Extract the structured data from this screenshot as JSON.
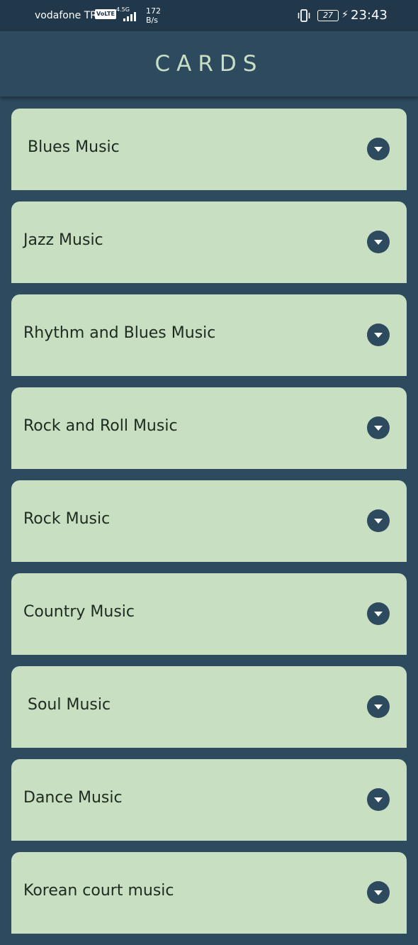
{
  "status_bar": {
    "carrier": "vodafone TR",
    "volte": "VoLTE",
    "network": "4.5G",
    "speed_value": "172",
    "speed_unit": "B/s",
    "battery": "27",
    "time": "23:43"
  },
  "app_bar": {
    "title": "CARDS"
  },
  "cards": [
    {
      "label": "Blues Music"
    },
    {
      "label": "Jazz Music"
    },
    {
      "label": "Rhythm and Blues Music"
    },
    {
      "label": "Rock and Roll Music"
    },
    {
      "label": "Rock Music"
    },
    {
      "label": "Country Music"
    },
    {
      "label": "Soul Music"
    },
    {
      "label": "Dance Music"
    },
    {
      "label": "Korean court music"
    }
  ],
  "icons": {
    "expand": "chevron-down-icon",
    "vibrate": "vibrate-icon",
    "battery": "battery-icon",
    "charging": "charging-icon",
    "signal": "signal-icon"
  },
  "colors": {
    "background": "#2d4a5f",
    "status_bar": "#21374a",
    "card": "#c8dfc1",
    "title": "#c9dfc4"
  }
}
